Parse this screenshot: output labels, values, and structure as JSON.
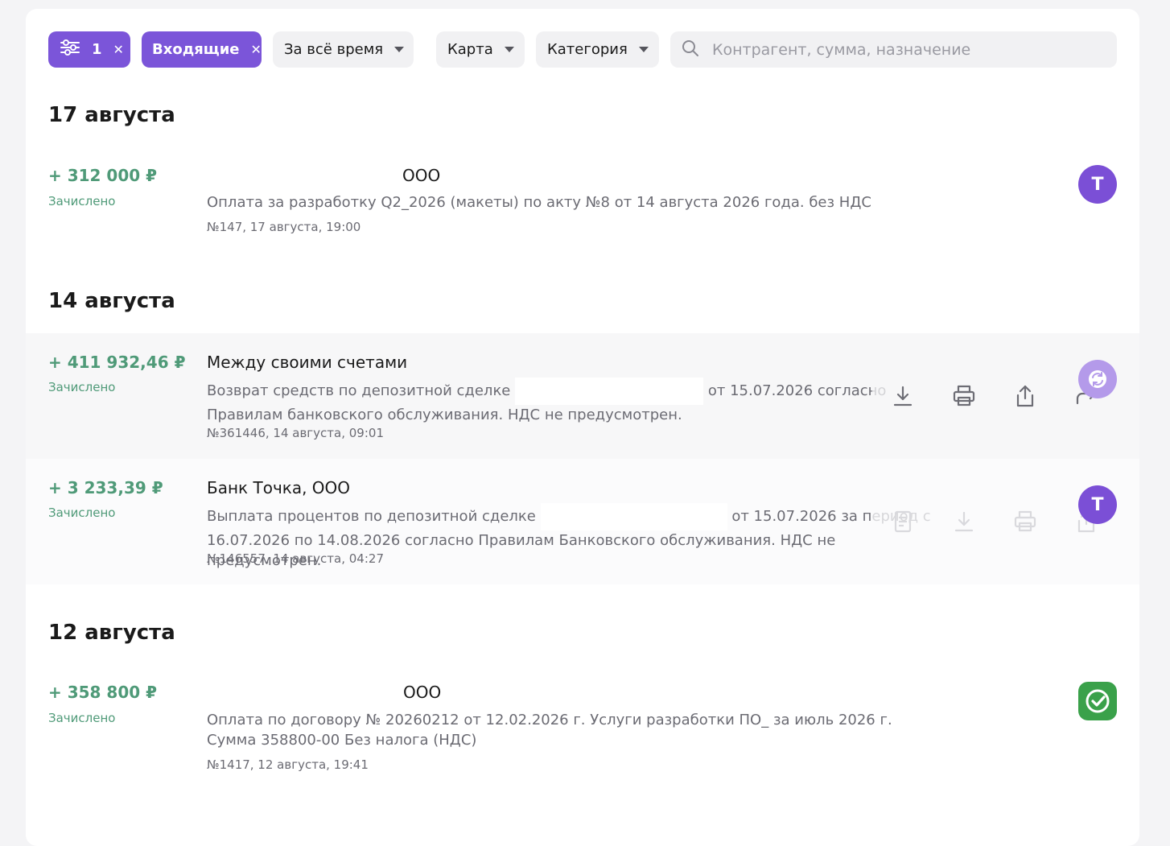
{
  "filters": {
    "params_count": "1",
    "direction": "Входящие",
    "period": "За всё время",
    "card": "Карта",
    "category": "Категория",
    "search_placeholder": "Контрагент, сумма, назначение"
  },
  "groups": [
    {
      "date": "17 августа",
      "items": [
        {
          "amount": "+ 312 000 ₽",
          "status": "Зачислено",
          "counterparty": "ООО",
          "purpose": "Оплата за разработку Q2_2026 (макеты) по акту №8 от 14 августа 2026 года. без НДС",
          "meta": "№147, 17 августа, 19:00",
          "bank_icon": "T",
          "bank_color": "#7b4fd6"
        }
      ]
    },
    {
      "date": "14 августа",
      "items": [
        {
          "amount": "+ 411 932,46 ₽",
          "status": "Зачислено",
          "counterparty": "Между своими счетами",
          "purpose_a": "Возврат средств по депозитной сделке",
          "purpose_b": "от 15.07.2026 согласно Правилам банковского обслуживания. НДС не предусмотрен.",
          "meta": "№361446, 14 августа, 09:01",
          "bank_icon": "transfer-icon"
        },
        {
          "amount": "+ 3 233,39 ₽",
          "status": "Зачислено",
          "counterparty": "Банк Точка, ООО",
          "purpose_a": "Выплата процентов по депозитной сделке",
          "purpose_b": "от 15.07.2026 за период с 16.07.2026 по 14.08.2026 согласно Правилам Банковского обслуживания. НДС не предусмотрен.",
          "meta": "№146557, 14 августа, 04:27",
          "bank_icon": "T",
          "bank_color": "#7b4fd6"
        }
      ]
    },
    {
      "date": "12 августа",
      "items": [
        {
          "amount": "+ 358 800 ₽",
          "status": "Зачислено",
          "counterparty": "ООО",
          "purpose": "Оплата по договору № 20260212 от 12.02.2026 г. Услуги разработки ПО_ за июль 2026 г. Сумма 358800-00 Без налога (НДС)",
          "meta": "№1417, 12 августа, 19:41",
          "bank_icon": "check-icon",
          "bank_color": "#3aa14a"
        }
      ]
    }
  ]
}
